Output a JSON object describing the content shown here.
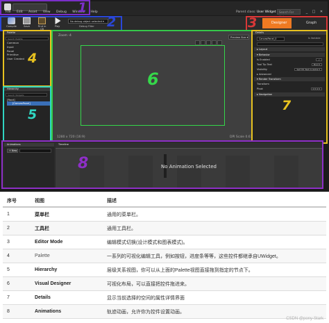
{
  "menubar": {
    "doc_tab": "",
    "menus": [
      "File",
      "Edit",
      "Asset",
      "View",
      "Debug",
      "Window",
      "Help"
    ],
    "parent_class_label": "Parent class:",
    "parent_class_value": "User Widget",
    "search_placeholder": "Search For Help",
    "window_buttons": [
      "_",
      "□",
      "✕"
    ]
  },
  "toolbar": {
    "buttons": [
      {
        "label": "Compile",
        "icon": "compile-icon"
      },
      {
        "label": "Save",
        "icon": "save-icon"
      },
      {
        "label": "Find in CB",
        "icon": "find-in-content-browser-icon"
      },
      {
        "label": "Play",
        "icon": "play-icon"
      }
    ],
    "debug_select": "No debug object selected ▾",
    "debug_filter": "Debug Filter"
  },
  "mode": {
    "designer_label": "Designer",
    "graph_label": "Graph"
  },
  "palette": {
    "title": "Palette",
    "search_placeholder": "Search Palette",
    "categories": [
      "Common",
      "Input",
      "Panel",
      "Primitive",
      "User Created"
    ]
  },
  "hierarchy": {
    "title": "Hierarchy",
    "search_placeholder": "Search Widgets",
    "root": "[Root]",
    "canvas": "[CanvasPanel]"
  },
  "designer": {
    "zoom": "Zoom -4",
    "preview_size": "Preview Size ▾",
    "resolution": "1280 x 720 (16:9)",
    "dpi": "DPI Scale 0.67"
  },
  "details": {
    "title": "Details",
    "name": "CanvasPanel_0",
    "is_variable": "Is Variable",
    "rows": [
      {
        "label": "▸ Layout",
        "section": true,
        "value": ""
      },
      {
        "label": "▾ Behavior",
        "section": true,
        "value": ""
      },
      {
        "label": "Is Enabled",
        "section": false,
        "value": "✓"
      },
      {
        "label": "Tool Tip Text",
        "section": false,
        "value": "Bind ▾"
      },
      {
        "label": "Visibility",
        "section": false,
        "value": "Self Hit Test Invisible ▾"
      },
      {
        "label": "▸ Advanced",
        "section": false,
        "value": ""
      },
      {
        "label": "▾ Render Transform",
        "section": true,
        "value": ""
      },
      {
        "label": "Transform",
        "section": false,
        "value": ""
      },
      {
        "label": "Pivot",
        "section": false,
        "value": "0.5  0.5"
      },
      {
        "label": "▸ Navigation",
        "section": true,
        "value": ""
      }
    ]
  },
  "animations": {
    "title": "Animations",
    "timeline_title": "Timeline",
    "new_label": "+ New",
    "empty_text": "No Animation Selected"
  },
  "table": {
    "headers": [
      "序号",
      "视图",
      "描述"
    ],
    "rows": [
      {
        "num": "1",
        "view": "菜单栏",
        "desc": "通用的菜单栏。",
        "bold": true
      },
      {
        "num": "2",
        "view": "工具栏",
        "desc": "通用工具栏。",
        "bold": true
      },
      {
        "num": "3",
        "view": "Editor Mode",
        "desc": "编辑模式切换(设计模式和图表模式)。",
        "bold": true
      },
      {
        "num": "4",
        "view": "Palette",
        "desc": "一系列的可视化编辑工具，例如按钮，进度条等等，这些控件都继承自UWidget。",
        "bold": false
      },
      {
        "num": "5",
        "view": "Hierarchy",
        "desc": "层级关系视图，你可以从上面的Palette视图直接拖到指定的节点下。",
        "bold": true
      },
      {
        "num": "6",
        "view": "Visual Designer",
        "desc": "可视化布局，可以直接把控件拖进来。",
        "bold": true
      },
      {
        "num": "7",
        "view": "Details",
        "desc": "显示当前选择的空间的属性详情界面",
        "bold": true
      },
      {
        "num": "8",
        "view": "Animations",
        "desc": "轨迹动画，允许你为控件设置动画。",
        "bold": true
      }
    ]
  },
  "annotations": {
    "n1": "1",
    "n2": "2",
    "n3": "3",
    "n4": "4",
    "n5": "5",
    "n6": "6",
    "n7": "7",
    "n8": "8"
  },
  "colors": {
    "purple": "#7b2fc9",
    "blue": "#2a47d8",
    "red": "#d93838",
    "yellow": "#e8c21f",
    "cyan": "#30d6c2",
    "green": "#35c84a",
    "orange": "#f07a22"
  },
  "watermark": "CSDN @pony-Stark"
}
